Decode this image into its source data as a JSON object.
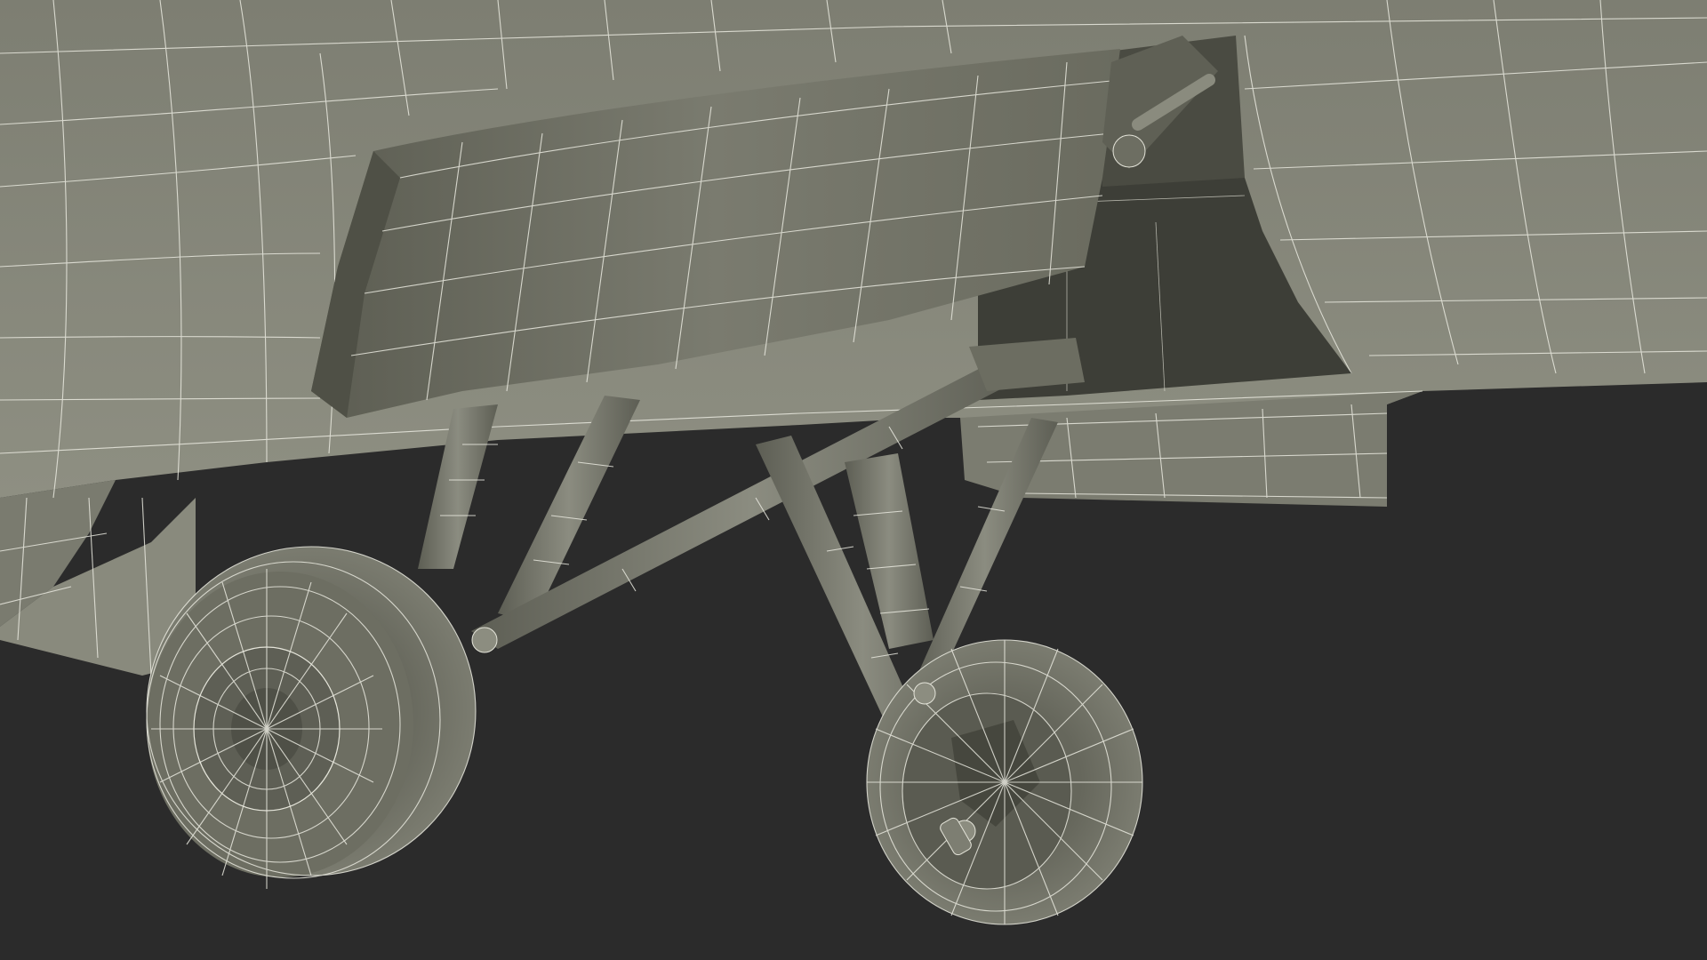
{
  "scene": {
    "subject": "wireframe-render",
    "colors": {
      "background": "#2b2b2b",
      "surface_light": "#86877a",
      "surface_mid": "#6f7064",
      "surface_dark": "#55564b",
      "bay_shadow": "#3d3e37",
      "wireframe": "#e9e9df"
    }
  }
}
